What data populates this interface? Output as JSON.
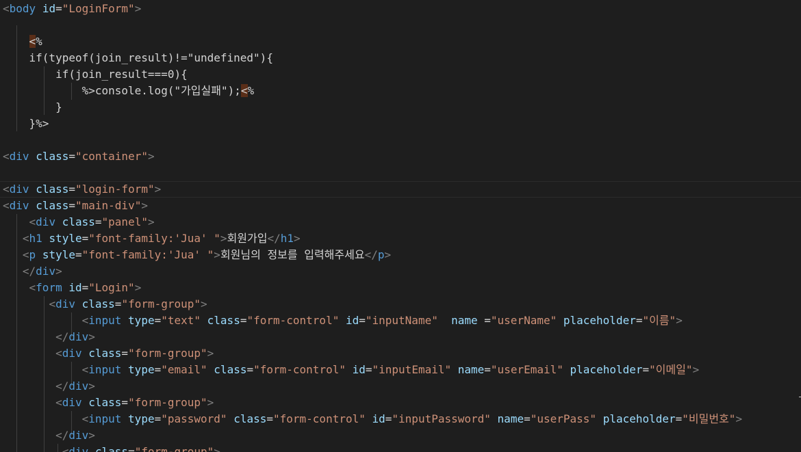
{
  "editor": {
    "colors": {
      "background": "#1e1e1e",
      "tag": "#569cd6",
      "bracket": "#808080",
      "attribute": "#9cdcfe",
      "string": "#ce9178",
      "text": "#d4d4d4",
      "delimiter_highlight": "#5a2e18"
    },
    "lines": [
      {
        "tokens": [
          {
            "c": "punc",
            "t": "<"
          },
          {
            "c": "tag",
            "t": "body"
          },
          {
            "c": "txt",
            "t": " "
          },
          {
            "c": "attr",
            "t": "id"
          },
          {
            "c": "txt",
            "t": "="
          },
          {
            "c": "str",
            "t": "\"LoginForm\""
          },
          {
            "c": "punc",
            "t": ">"
          }
        ]
      },
      {
        "tokens": []
      },
      {
        "tokens": [
          {
            "c": "txt",
            "t": "    "
          },
          {
            "c": "delim",
            "t": "<"
          },
          {
            "c": "txt",
            "t": "%"
          }
        ]
      },
      {
        "tokens": [
          {
            "c": "txt",
            "t": "    if(typeof(join_result)!=\"undefined\"){"
          }
        ]
      },
      {
        "tokens": [
          {
            "c": "txt",
            "t": "        if(join_result===0){"
          }
        ]
      },
      {
        "tokens": [
          {
            "c": "txt",
            "t": "            %>console.log(\"가입실패\");"
          },
          {
            "c": "delim",
            "t": "<"
          },
          {
            "c": "txt",
            "t": "%"
          }
        ]
      },
      {
        "tokens": [
          {
            "c": "txt",
            "t": "        }"
          }
        ]
      },
      {
        "tokens": [
          {
            "c": "txt",
            "t": "    }%>"
          }
        ]
      },
      {
        "tokens": []
      },
      {
        "tokens": [
          {
            "c": "punc",
            "t": "<"
          },
          {
            "c": "tag",
            "t": "div"
          },
          {
            "c": "txt",
            "t": " "
          },
          {
            "c": "attr",
            "t": "class"
          },
          {
            "c": "txt",
            "t": "="
          },
          {
            "c": "str",
            "t": "\"container\""
          },
          {
            "c": "punc",
            "t": ">"
          }
        ]
      },
      {
        "tokens": []
      },
      {
        "tokens": [
          {
            "c": "punc",
            "t": "<"
          },
          {
            "c": "tag",
            "t": "div"
          },
          {
            "c": "txt",
            "t": " "
          },
          {
            "c": "attr",
            "t": "class"
          },
          {
            "c": "txt",
            "t": "="
          },
          {
            "c": "str",
            "t": "\"login-form\""
          },
          {
            "c": "punc",
            "t": ">"
          }
        ]
      },
      {
        "tokens": [
          {
            "c": "punc",
            "t": "<"
          },
          {
            "c": "tag",
            "t": "div"
          },
          {
            "c": "txt",
            "t": " "
          },
          {
            "c": "attr",
            "t": "class"
          },
          {
            "c": "txt",
            "t": "="
          },
          {
            "c": "str",
            "t": "\"main-div\""
          },
          {
            "c": "punc",
            "t": ">"
          }
        ]
      },
      {
        "tokens": [
          {
            "c": "txt",
            "t": "    "
          },
          {
            "c": "punc",
            "t": "<"
          },
          {
            "c": "tag",
            "t": "div"
          },
          {
            "c": "txt",
            "t": " "
          },
          {
            "c": "attr",
            "t": "class"
          },
          {
            "c": "txt",
            "t": "="
          },
          {
            "c": "str",
            "t": "\"panel\""
          },
          {
            "c": "punc",
            "t": ">"
          }
        ]
      },
      {
        "tokens": [
          {
            "c": "txt",
            "t": "   "
          },
          {
            "c": "punc",
            "t": "<"
          },
          {
            "c": "tag",
            "t": "h1"
          },
          {
            "c": "txt",
            "t": " "
          },
          {
            "c": "attr",
            "t": "style"
          },
          {
            "c": "txt",
            "t": "="
          },
          {
            "c": "str",
            "t": "\"font-family:'Jua' \""
          },
          {
            "c": "punc",
            "t": ">"
          },
          {
            "c": "txt",
            "t": "회원가입"
          },
          {
            "c": "punc",
            "t": "</"
          },
          {
            "c": "tag",
            "t": "h1"
          },
          {
            "c": "punc",
            "t": ">"
          }
        ]
      },
      {
        "tokens": [
          {
            "c": "txt",
            "t": "   "
          },
          {
            "c": "punc",
            "t": "<"
          },
          {
            "c": "tag",
            "t": "p"
          },
          {
            "c": "txt",
            "t": " "
          },
          {
            "c": "attr",
            "t": "style"
          },
          {
            "c": "txt",
            "t": "="
          },
          {
            "c": "str",
            "t": "\"font-family:'Jua' \""
          },
          {
            "c": "punc",
            "t": ">"
          },
          {
            "c": "txt",
            "t": "회원님의 정보를 입력해주세요"
          },
          {
            "c": "punc",
            "t": "</"
          },
          {
            "c": "tag",
            "t": "p"
          },
          {
            "c": "punc",
            "t": ">"
          }
        ]
      },
      {
        "tokens": [
          {
            "c": "txt",
            "t": "   "
          },
          {
            "c": "punc",
            "t": "</"
          },
          {
            "c": "tag",
            "t": "div"
          },
          {
            "c": "punc",
            "t": ">"
          }
        ]
      },
      {
        "tokens": [
          {
            "c": "txt",
            "t": "    "
          },
          {
            "c": "punc",
            "t": "<"
          },
          {
            "c": "tag",
            "t": "form"
          },
          {
            "c": "txt",
            "t": " "
          },
          {
            "c": "attr",
            "t": "id"
          },
          {
            "c": "txt",
            "t": "="
          },
          {
            "c": "str",
            "t": "\"Login\""
          },
          {
            "c": "punc",
            "t": ">"
          }
        ]
      },
      {
        "tokens": [
          {
            "c": "txt",
            "t": "       "
          },
          {
            "c": "punc",
            "t": "<"
          },
          {
            "c": "tag",
            "t": "div"
          },
          {
            "c": "txt",
            "t": " "
          },
          {
            "c": "attr",
            "t": "class"
          },
          {
            "c": "txt",
            "t": "="
          },
          {
            "c": "str",
            "t": "\"form-group\""
          },
          {
            "c": "punc",
            "t": ">"
          }
        ]
      },
      {
        "tokens": [
          {
            "c": "txt",
            "t": "            "
          },
          {
            "c": "punc",
            "t": "<"
          },
          {
            "c": "tag",
            "t": "input"
          },
          {
            "c": "txt",
            "t": " "
          },
          {
            "c": "attr",
            "t": "type"
          },
          {
            "c": "txt",
            "t": "="
          },
          {
            "c": "str",
            "t": "\"text\""
          },
          {
            "c": "txt",
            "t": " "
          },
          {
            "c": "attr",
            "t": "class"
          },
          {
            "c": "txt",
            "t": "="
          },
          {
            "c": "str",
            "t": "\"form-control\""
          },
          {
            "c": "txt",
            "t": " "
          },
          {
            "c": "attr",
            "t": "id"
          },
          {
            "c": "txt",
            "t": "="
          },
          {
            "c": "str",
            "t": "\"inputName\""
          },
          {
            "c": "txt",
            "t": "  "
          },
          {
            "c": "attr",
            "t": "name"
          },
          {
            "c": "txt",
            "t": " ="
          },
          {
            "c": "str",
            "t": "\"userName\""
          },
          {
            "c": "txt",
            "t": " "
          },
          {
            "c": "attr",
            "t": "placeholder"
          },
          {
            "c": "txt",
            "t": "="
          },
          {
            "c": "str",
            "t": "\"이름\""
          },
          {
            "c": "punc",
            "t": ">"
          }
        ]
      },
      {
        "tokens": [
          {
            "c": "txt",
            "t": "        "
          },
          {
            "c": "punc",
            "t": "</"
          },
          {
            "c": "tag",
            "t": "div"
          },
          {
            "c": "punc",
            "t": ">"
          }
        ]
      },
      {
        "tokens": [
          {
            "c": "txt",
            "t": "        "
          },
          {
            "c": "punc",
            "t": "<"
          },
          {
            "c": "tag",
            "t": "div"
          },
          {
            "c": "txt",
            "t": " "
          },
          {
            "c": "attr",
            "t": "class"
          },
          {
            "c": "txt",
            "t": "="
          },
          {
            "c": "str",
            "t": "\"form-group\""
          },
          {
            "c": "punc",
            "t": ">"
          }
        ]
      },
      {
        "tokens": [
          {
            "c": "txt",
            "t": "            "
          },
          {
            "c": "punc",
            "t": "<"
          },
          {
            "c": "tag",
            "t": "input"
          },
          {
            "c": "txt",
            "t": " "
          },
          {
            "c": "attr",
            "t": "type"
          },
          {
            "c": "txt",
            "t": "="
          },
          {
            "c": "str",
            "t": "\"email\""
          },
          {
            "c": "txt",
            "t": " "
          },
          {
            "c": "attr",
            "t": "class"
          },
          {
            "c": "txt",
            "t": "="
          },
          {
            "c": "str",
            "t": "\"form-control\""
          },
          {
            "c": "txt",
            "t": " "
          },
          {
            "c": "attr",
            "t": "id"
          },
          {
            "c": "txt",
            "t": "="
          },
          {
            "c": "str",
            "t": "\"inputEmail\""
          },
          {
            "c": "txt",
            "t": " "
          },
          {
            "c": "attr",
            "t": "name"
          },
          {
            "c": "txt",
            "t": "="
          },
          {
            "c": "str",
            "t": "\"userEmail\""
          },
          {
            "c": "txt",
            "t": " "
          },
          {
            "c": "attr",
            "t": "placeholder"
          },
          {
            "c": "txt",
            "t": "="
          },
          {
            "c": "str",
            "t": "\"이메일\""
          },
          {
            "c": "punc",
            "t": ">"
          }
        ]
      },
      {
        "tokens": [
          {
            "c": "txt",
            "t": "        "
          },
          {
            "c": "punc",
            "t": "</"
          },
          {
            "c": "tag",
            "t": "div"
          },
          {
            "c": "punc",
            "t": ">"
          }
        ]
      },
      {
        "tokens": [
          {
            "c": "txt",
            "t": "        "
          },
          {
            "c": "punc",
            "t": "<"
          },
          {
            "c": "tag",
            "t": "div"
          },
          {
            "c": "txt",
            "t": " "
          },
          {
            "c": "attr",
            "t": "class"
          },
          {
            "c": "txt",
            "t": "="
          },
          {
            "c": "str",
            "t": "\"form-group\""
          },
          {
            "c": "punc",
            "t": ">"
          }
        ]
      },
      {
        "tokens": [
          {
            "c": "txt",
            "t": "            "
          },
          {
            "c": "punc",
            "t": "<"
          },
          {
            "c": "tag",
            "t": "input"
          },
          {
            "c": "txt",
            "t": " "
          },
          {
            "c": "attr",
            "t": "type"
          },
          {
            "c": "txt",
            "t": "="
          },
          {
            "c": "str",
            "t": "\"password\""
          },
          {
            "c": "txt",
            "t": " "
          },
          {
            "c": "attr",
            "t": "class"
          },
          {
            "c": "txt",
            "t": "="
          },
          {
            "c": "str",
            "t": "\"form-control\""
          },
          {
            "c": "txt",
            "t": " "
          },
          {
            "c": "attr",
            "t": "id"
          },
          {
            "c": "txt",
            "t": "="
          },
          {
            "c": "str",
            "t": "\"inputPassword\""
          },
          {
            "c": "txt",
            "t": " "
          },
          {
            "c": "attr",
            "t": "name"
          },
          {
            "c": "txt",
            "t": "="
          },
          {
            "c": "str",
            "t": "\"userPass\""
          },
          {
            "c": "txt",
            "t": " "
          },
          {
            "c": "attr",
            "t": "placeholder"
          },
          {
            "c": "txt",
            "t": "="
          },
          {
            "c": "str",
            "t": "\"비밀번호\""
          },
          {
            "c": "punc",
            "t": ">"
          }
        ]
      },
      {
        "tokens": [
          {
            "c": "txt",
            "t": "        "
          },
          {
            "c": "punc",
            "t": "</"
          },
          {
            "c": "tag",
            "t": "div"
          },
          {
            "c": "punc",
            "t": ">"
          }
        ]
      },
      {
        "tokens": [
          {
            "c": "txt",
            "t": "         "
          },
          {
            "c": "punc",
            "t": "<"
          },
          {
            "c": "tag",
            "t": "div"
          },
          {
            "c": "txt",
            "t": " "
          },
          {
            "c": "attr",
            "t": "class"
          },
          {
            "c": "txt",
            "t": "="
          },
          {
            "c": "str",
            "t": "\"form-group\""
          },
          {
            "c": "punc",
            "t": ">"
          }
        ]
      }
    ]
  }
}
